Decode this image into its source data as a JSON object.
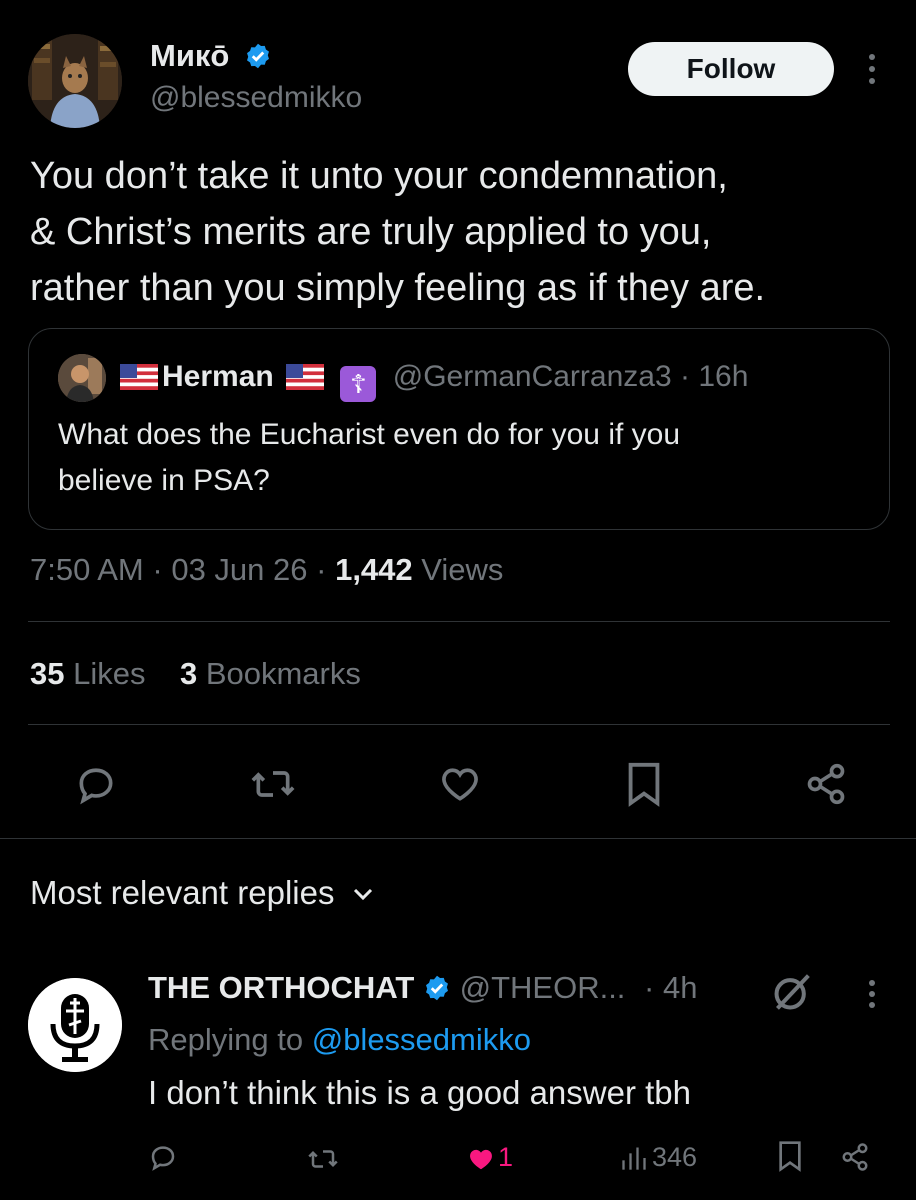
{
  "colors": {
    "accent": "#1d9bf0",
    "muted": "#71767b",
    "like_active": "#f91880",
    "background": "#000000"
  },
  "author": {
    "display_name": "Микō",
    "handle": "@blessedmikko",
    "follow_label": "Follow",
    "verified_icon": "verified-badge-icon"
  },
  "tweet": {
    "text": "You don’t take it unto your condemnation,\n& Christ’s merits are truly applied to you,\nrather than you simply feeling as if they are."
  },
  "quote": {
    "name": "Herman",
    "flag_left": "us-flag-icon",
    "flag_right": "us-flag-icon",
    "badge": "☦",
    "handle": "@GermanCarranza3",
    "separator": "·",
    "time": "16h",
    "text": "What does the Eucharist even do for you if you\nbelieve in PSA?"
  },
  "meta": {
    "time": "7:50 AM",
    "separator": "·",
    "date": "03 Jun 26",
    "views_count": "1,442",
    "views_label": "Views"
  },
  "stats": {
    "likes_count": "35",
    "likes_label": "Likes",
    "bookmarks_count": "3",
    "bookmarks_label": "Bookmarks"
  },
  "actions": [
    "reply-icon",
    "retweet-icon",
    "like-icon",
    "bookmark-icon",
    "share-icon"
  ],
  "replies_header": {
    "label": "Most relevant replies"
  },
  "reply": {
    "name": "THE ORTHOCHAT",
    "handle": "@THEOR...",
    "separator": "·",
    "time": "4h",
    "replying_prefix": "Replying to",
    "replying_mention": "@blessedmikko",
    "text": "I don’t think this is a good answer tbh",
    "likes": "1",
    "views": "346"
  }
}
